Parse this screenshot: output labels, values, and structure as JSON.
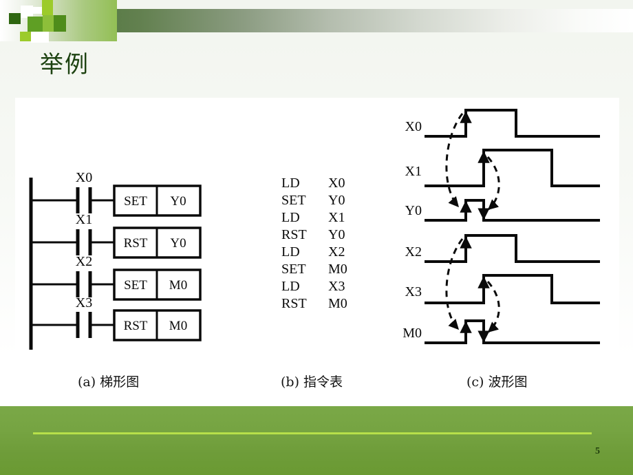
{
  "slide": {
    "title": "举例",
    "page_number": "5",
    "accent_dark_green": "#3f6b31",
    "accent_light_green": "#93bf55",
    "footer_green": "#76a442",
    "footer_rule_green": "#b7e04a",
    "title_color": "#1d4211"
  },
  "captions": {
    "a": "(a) 梯形图",
    "b": "(b) 指令表",
    "c": "(c) 波形图"
  },
  "ladder": {
    "rungs": [
      {
        "contact": "X0",
        "instruction": "SET",
        "operand": "Y0"
      },
      {
        "contact": "X1",
        "instruction": "RST",
        "operand": "Y0"
      },
      {
        "contact": "X2",
        "instruction": "SET",
        "operand": "M0"
      },
      {
        "contact": "X3",
        "instruction": "RST",
        "operand": "M0"
      }
    ]
  },
  "instruction_list": {
    "lines": [
      {
        "op": "LD",
        "operand": "X0"
      },
      {
        "op": "SET",
        "operand": "Y0"
      },
      {
        "op": "LD",
        "operand": "X1"
      },
      {
        "op": "RST",
        "operand": "Y0"
      },
      {
        "op": "LD",
        "operand": "X2"
      },
      {
        "op": "SET",
        "operand": "M0"
      },
      {
        "op": "LD",
        "operand": "X3"
      },
      {
        "op": "RST",
        "operand": "M0"
      }
    ]
  },
  "waveform": {
    "signals": [
      {
        "name": "X0"
      },
      {
        "name": "X1"
      },
      {
        "name": "Y0"
      },
      {
        "name": "X2"
      },
      {
        "name": "X3"
      },
      {
        "name": "M0"
      }
    ]
  }
}
